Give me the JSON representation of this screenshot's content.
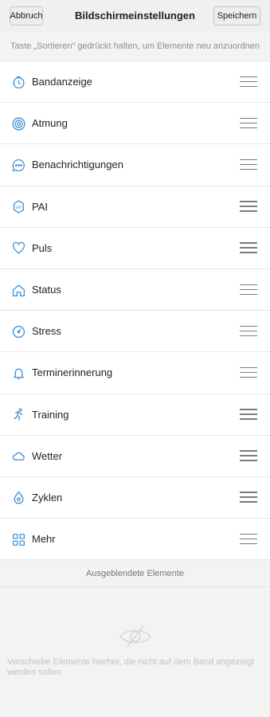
{
  "header": {
    "cancel_label": "Abbruch",
    "title": "Bildschirmeinstellungen",
    "save_label": "Speichern"
  },
  "hint": "Taste „Sortieren“ gedrückt halten, um Elemente neu anzuordnen",
  "items": [
    {
      "label": "Bandanzeige",
      "icon": "band-display-icon"
    },
    {
      "label": "Atmung",
      "icon": "breathing-icon"
    },
    {
      "label": "Benachrichtigungen",
      "icon": "notifications-icon"
    },
    {
      "label": "PAI",
      "icon": "pai-icon"
    },
    {
      "label": "Puls",
      "icon": "heart-icon"
    },
    {
      "label": "Status",
      "icon": "home-icon"
    },
    {
      "label": "Stress",
      "icon": "stress-icon"
    },
    {
      "label": "Terminerinnerung",
      "icon": "bell-icon"
    },
    {
      "label": "Training",
      "icon": "running-icon"
    },
    {
      "label": "Wetter",
      "icon": "cloud-icon"
    },
    {
      "label": "Zyklen",
      "icon": "cycle-icon"
    },
    {
      "label": "Mehr",
      "icon": "grid-icon"
    }
  ],
  "hidden_section": {
    "title": "Ausgeblendete Elemente",
    "empty_text": "Verschiebe Elemente hierher, die nicht auf dem Band angezeigt werden sollen",
    "icon": "eye-hidden-icon"
  },
  "colors": {
    "accent": "#3d8fd6",
    "handle": "#7a7a7a"
  }
}
